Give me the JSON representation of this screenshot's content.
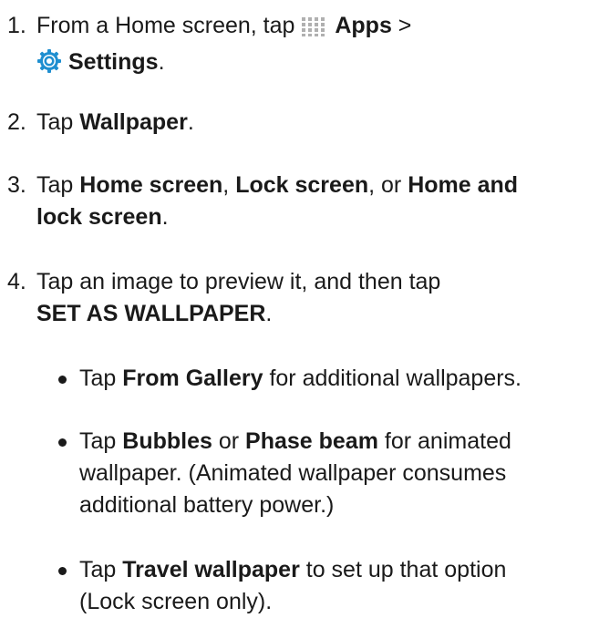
{
  "steps": [
    {
      "num": "1.",
      "line1": {
        "a": "From a Home screen, tap",
        "b": "Apps",
        "c": ">"
      },
      "line2": {
        "a": "Settings",
        "b": "."
      },
      "icons": {
        "apps": "apps-grid-icon",
        "settings": "settings-gear-icon"
      }
    },
    {
      "num": "2.",
      "a": "Tap",
      "b": "Wallpaper",
      "c": "."
    },
    {
      "num": "3.",
      "a": "Tap",
      "b": "Home screen",
      "c": ",",
      "d": "Lock screen",
      "e": ", or",
      "f": "Home and",
      "g": "lock screen",
      "h": "."
    },
    {
      "num": "4.",
      "line1": "Tap an image to preview it, and then tap",
      "line2": {
        "a": "SET AS WALLPAPER",
        "b": "."
      }
    }
  ],
  "bullets": [
    {
      "a": "Tap",
      "b": "From Gallery",
      "c": "for additional wallpapers."
    },
    {
      "a": "Tap",
      "b": "Bubbles",
      "c": "or",
      "d": "Phase beam",
      "e": "for animated",
      "line2": "wallpaper. (Animated wallpaper consumes",
      "line3": "additional battery power.)"
    },
    {
      "a": "Tap",
      "b": "Travel wallpaper",
      "c": "to set up that option",
      "line2": "(Lock screen only)."
    }
  ],
  "colors": {
    "text": "#1a1a1a",
    "apps_icon": "#b0b0b0",
    "settings_icon": "#1f8fd0"
  }
}
